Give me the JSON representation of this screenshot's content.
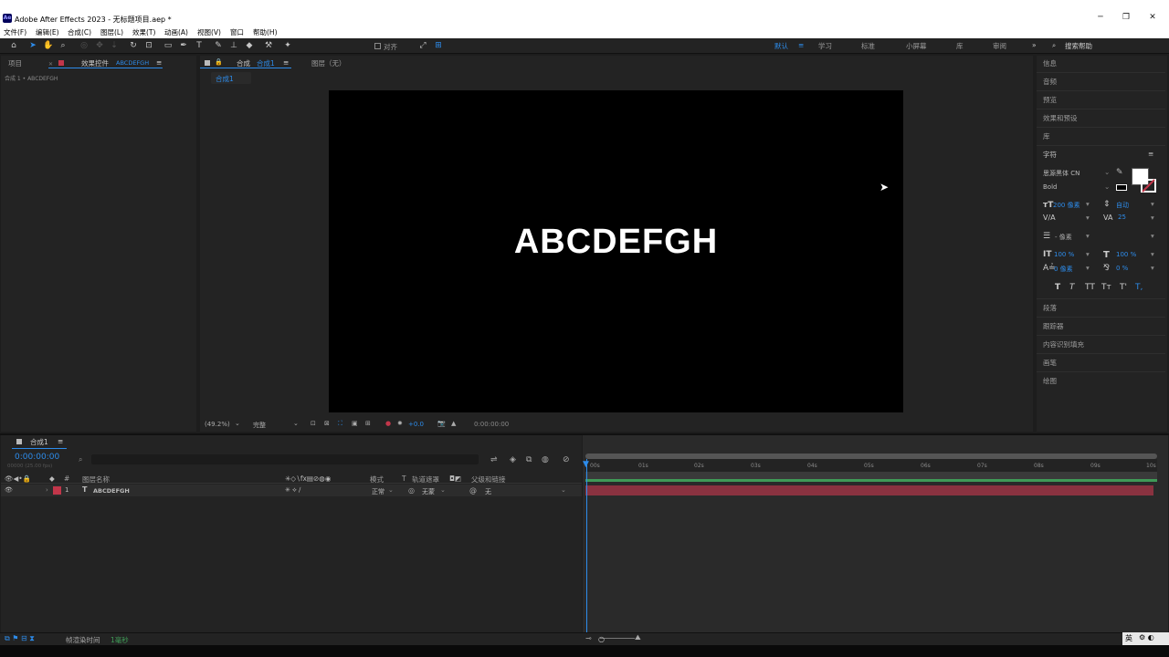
{
  "window": {
    "title": "Adobe After Effects 2023 - 无标题项目.aep *",
    "app_icon": "Ae"
  },
  "menu": [
    "文件(F)",
    "编辑(E)",
    "合成(C)",
    "图层(L)",
    "效果(T)",
    "动画(A)",
    "视图(V)",
    "窗口",
    "帮助(H)"
  ],
  "toolbar": {
    "align_label": "对齐",
    "workspaces": [
      "默认",
      "学习",
      "标准",
      "小屏幕",
      "库",
      "审阅"
    ],
    "active_workspace": "默认",
    "search_placeholder": "搜索帮助"
  },
  "left_panel": {
    "tab_project": "项目",
    "tab_effects": "效果控件",
    "tab_effects_layer": "ABCDEFGH",
    "breadcrumb": "合成 1 • ABCDEFGH"
  },
  "viewer": {
    "tab_label": "合成",
    "tab_comp": "合成1",
    "layer_tab": "图层（无）",
    "comp_chip": "合成1",
    "canvas_text": "ABCDEFGH",
    "zoom": "(49.2%)",
    "quality": "完整",
    "exposure": "+0.0",
    "timecode": "0:00:00:00"
  },
  "right_panel": {
    "items_top": [
      "信息",
      "音频",
      "预览",
      "效果和预设",
      "库"
    ],
    "character": {
      "title": "字符",
      "font_family": "思源黑体 CN",
      "font_style": "Bold",
      "font_size": "200 像素",
      "leading": "自动",
      "tracking": "25",
      "stroke": "- 像素",
      "vscale": "100 %",
      "hscale": "100 %",
      "baseline": "0 像素",
      "tsume": "0 %",
      "style_buttons": [
        "T",
        "T",
        "TT",
        "Tт",
        "T'",
        "T,"
      ]
    },
    "items_bottom": [
      "段落",
      "跟踪器",
      "内容识别填充",
      "画笔",
      "绘图"
    ]
  },
  "timeline": {
    "comp_tab": "合成1",
    "timecode": "0:00:00:00",
    "frame_info": "00000 (25.00 fps)",
    "search_placeholder": "",
    "columns": {
      "name": "图层名称",
      "mode": "模式",
      "trkmat_t": "T",
      "trkmat": "轨道遮罩",
      "parent": "父级和链接"
    },
    "ruler": [
      "00s",
      "01s",
      "02s",
      "03s",
      "04s",
      "05s",
      "06s",
      "07s",
      "08s",
      "09s",
      "10s"
    ],
    "layers": [
      {
        "index": "1",
        "type_icon": "T",
        "name": "ABCDEFGH",
        "mode": "正常",
        "trkmat": "无蒙",
        "parent": "无",
        "label_color": "#c2364a"
      }
    ],
    "footer": {
      "render_label": "帧渲染时间",
      "render_value": "1毫秒",
      "ime": "英"
    }
  },
  "colors": {
    "accent": "#2d8ceb",
    "layer_bar": "#8a3240",
    "work_area": "#3f9a57"
  }
}
